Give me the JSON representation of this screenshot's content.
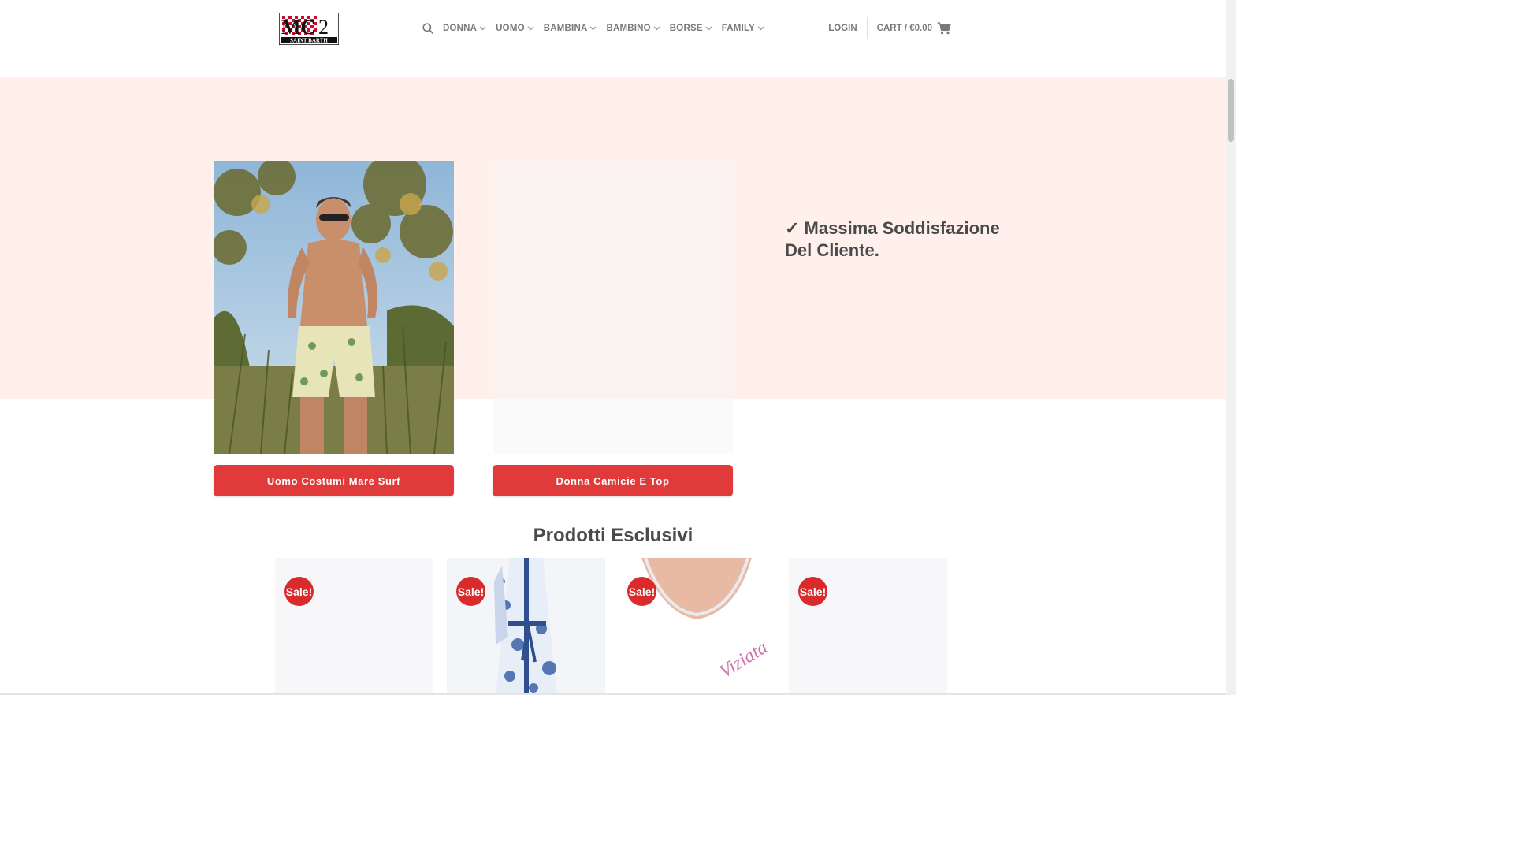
{
  "header": {
    "logo_text": "MC2",
    "logo_sub": "SAINT BARTH",
    "nav": [
      {
        "label": "DONNA"
      },
      {
        "label": "UOMO"
      },
      {
        "label": "BAMBINA"
      },
      {
        "label": "BAMBINO"
      },
      {
        "label": "BORSE"
      },
      {
        "label": "FAMILY"
      }
    ],
    "login": "LOGIN",
    "cart": "CART / €0.00"
  },
  "hero": {
    "cards": [
      {
        "button": "Uomo Costumi Mare Surf"
      },
      {
        "button": "Donna Camicie E Top"
      }
    ],
    "promise": "✓ Massima Soddisfazione Del Cliente."
  },
  "products": {
    "title": "Prodotti Esclusivi",
    "badge": "Sale!",
    "handwriting": "Viziata"
  },
  "colors": {
    "accent": "#e03a3a",
    "hero_bg": "#fff0ec",
    "nav_text": "#7a7a7a"
  }
}
